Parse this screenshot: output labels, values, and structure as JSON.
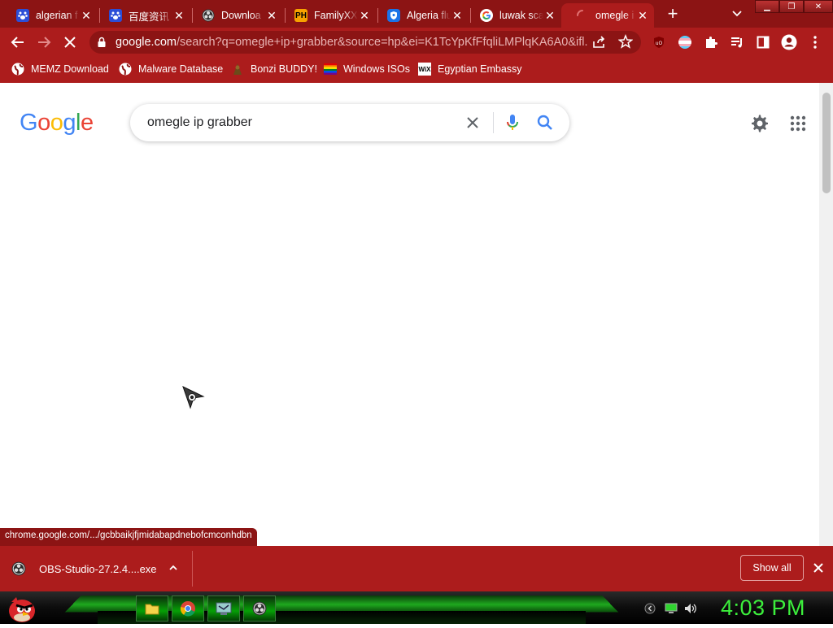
{
  "browser": {
    "tabs": [
      {
        "title": "algerian f",
        "favicon": "baidu-paw-icon",
        "active": false
      },
      {
        "title": "百度资讯",
        "favicon": "baidu-paw-icon",
        "active": false
      },
      {
        "title": "Downloa",
        "favicon": "obs-icon",
        "active": false
      },
      {
        "title": "FamilyXX",
        "favicon": "ph-icon",
        "favicon_text": "PH",
        "active": false
      },
      {
        "title": "Algeria flu",
        "favicon": "shield-icon",
        "active": false
      },
      {
        "title": "luwak sca",
        "favicon": "google-g-icon",
        "active": false
      },
      {
        "title": "omegle i",
        "favicon": "loading-spinner-icon",
        "active": true
      }
    ],
    "new_tab_label": "+",
    "address": {
      "host": "google.com",
      "rest": "/search?q=omegle+ip+grabber&source=hp&ei=K1TcYpKfFfqliLMPlqKA6A0&ifl..."
    },
    "bookmarks": [
      {
        "label": "MEMZ Download",
        "icon": "globe-icon"
      },
      {
        "label": "Malware Database",
        "icon": "globe-icon"
      },
      {
        "label": "Bonzi BUDDY!",
        "icon": "bonzi-icon"
      },
      {
        "label": "Windows ISOs",
        "icon": "rainbow-flag-icon"
      },
      {
        "label": "Egyptian Embassy",
        "icon": "wix-icon",
        "icon_text": "WiX"
      }
    ],
    "status_url": "chrome.google.com/.../gcbbaikjfjmidabapdnebofcmconhdbn",
    "colors": {
      "frame": "#8c1414",
      "toolbar": "#ac1c1c",
      "clock": "#3cf03c"
    }
  },
  "google": {
    "logo_letters": [
      "G",
      "o",
      "o",
      "g",
      "l",
      "e"
    ],
    "logo_colors": [
      "#4285f4",
      "#ea4335",
      "#fbbc05",
      "#4285f4",
      "#34a853",
      "#ea4335"
    ],
    "query": "omegle ip grabber"
  },
  "downloads": {
    "filename": "OBS-Studio-27.2.4....exe",
    "show_all_label": "Show all"
  },
  "taskbar": {
    "clock": "4:03 PM"
  }
}
